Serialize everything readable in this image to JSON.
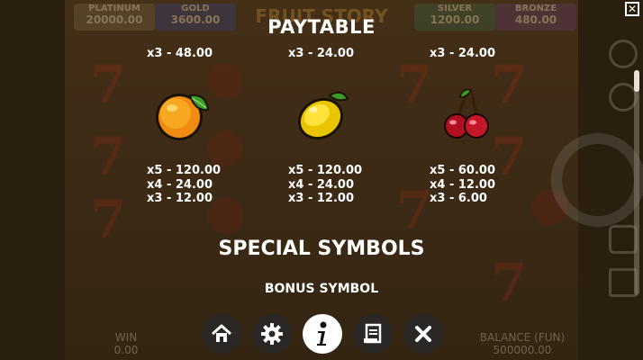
{
  "backdrop": {
    "jackpots": [
      {
        "label": "PLATINUM",
        "value": "20000.00"
      },
      {
        "label": "GOLD",
        "value": "3600.00"
      },
      {
        "label": "SILVER",
        "value": "1200.00"
      },
      {
        "label": "BRONZE",
        "value": "480.00"
      }
    ],
    "game_title": "FRUIT STORY",
    "win_label": "WIN",
    "win_value": "0.00",
    "balance_label": "BALANCE (FUN)",
    "balance_value": "500000.00"
  },
  "paytable": {
    "title": "PAYTABLE",
    "symbols": [
      {
        "icon": "orange-icon",
        "top_pay": "x3 - 48.00",
        "pays": [
          "x5 - 120.00",
          "x4 - 24.00",
          "x3 - 12.00"
        ]
      },
      {
        "icon": "lemon-icon",
        "top_pay": "x3 - 24.00",
        "pays": [
          "x5 - 120.00",
          "x4 - 24.00",
          "x3 - 12.00"
        ]
      },
      {
        "icon": "cherry-icon",
        "top_pay": "x3 - 24.00",
        "pays": [
          "x5 - 60.00",
          "x4 - 12.00",
          "x3 - 6.00"
        ]
      }
    ],
    "special_title": "SPECIAL SYMBOLS",
    "bonus_label": "BONUS SYMBOL"
  },
  "toolbar": {
    "buttons": [
      {
        "icon": "home-icon"
      },
      {
        "icon": "gear-icon"
      },
      {
        "icon": "info-icon",
        "active": true
      },
      {
        "icon": "scroll-icon"
      },
      {
        "icon": "close-icon"
      }
    ]
  },
  "colors": {
    "active_button": "#ffffff",
    "button": "#2b2724",
    "text": "#ffffff"
  }
}
